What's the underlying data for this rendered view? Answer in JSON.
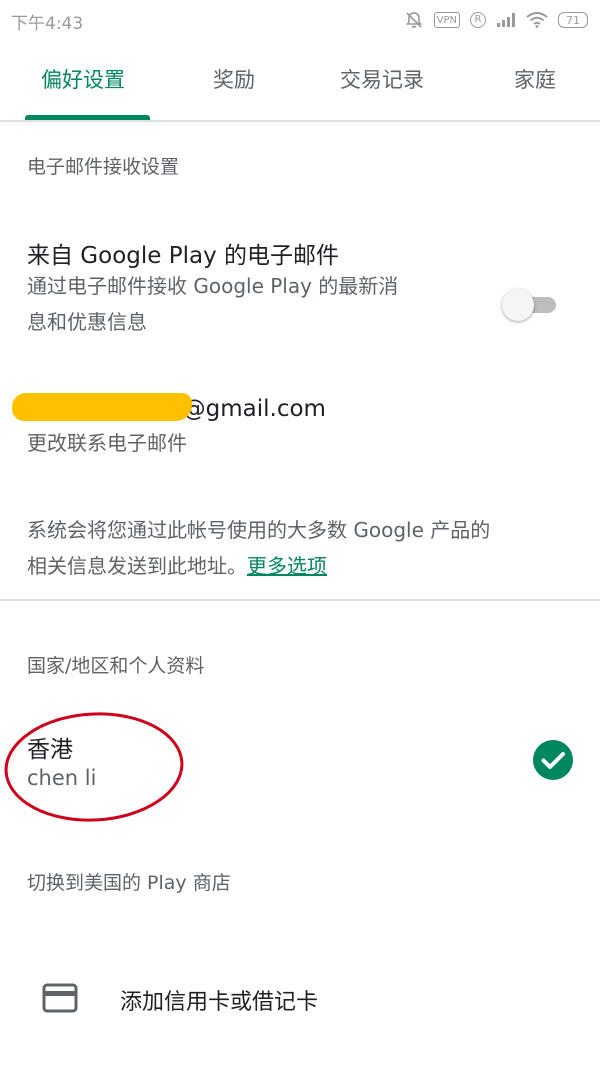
{
  "status_bar": {
    "time": "下午4:43",
    "vpn": "VPN",
    "r_badge": "R",
    "battery": "71"
  },
  "tabs": [
    {
      "label": "偏好设置",
      "active": true
    },
    {
      "label": "奖励",
      "active": false
    },
    {
      "label": "交易记录",
      "active": false
    },
    {
      "label": "家庭",
      "active": false
    }
  ],
  "email_section": {
    "header": "电子邮件接收设置",
    "play_email_title": "来自 Google Play 的电子邮件",
    "play_email_desc_line1": "通过电子邮件接收 Google Play 的最新消",
    "play_email_desc_line2": "息和优惠信息",
    "toggle_on": false,
    "email_visible_suffix": "2@gmail.com",
    "change_email": "更改联系电子邮件",
    "info_line1": "系统会将您通过此帐号使用的大多数 Google 产品的",
    "info_line2": "相关信息发送到此地址。",
    "more_options": "更多选项"
  },
  "country_section": {
    "header": "国家/地区和个人资料",
    "country": "香港",
    "profile_name": "chen li",
    "switch_store": "切换到美国的 Play 商店"
  },
  "payment": {
    "add_card": "添加信用卡或借记卡"
  },
  "colors": {
    "accent": "#01875f",
    "annotation_red": "#d0021b",
    "redaction": "#ffc000"
  },
  "icons": {
    "notification_off": "bell-off-icon",
    "signal": "signal-icon",
    "wifi": "wifi-icon",
    "check": "check-circle-icon",
    "card": "credit-card-icon"
  }
}
